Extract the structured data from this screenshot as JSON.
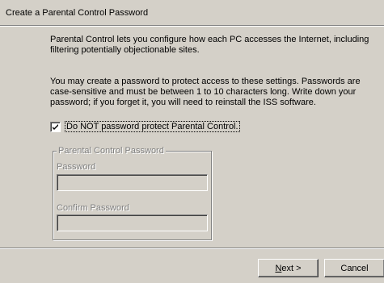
{
  "dialog": {
    "title": "Create a Parental Control Password",
    "intro": "Parental Control lets you configure how each PC accesses the Internet, including filtering potentially objectionable sites.",
    "instructions": "You may create a password to protect access to these settings. Passwords are case-sensitive and must be between 1 to 10 characters long. Write down your password; if you forget it, you will need to reinstall the ISS software."
  },
  "checkbox": {
    "label": "Do NOT password protect Parental Control.",
    "checked": true
  },
  "group": {
    "legend": "Parental Control Password",
    "password_label": "Password",
    "password_value": "",
    "confirm_label": "Confirm Password",
    "confirm_value": ""
  },
  "buttons": {
    "next_mnemonic": "N",
    "next_rest": "ext >",
    "cancel": "Cancel"
  },
  "colors": {
    "face": "#d4d0c8",
    "shadow": "#808080",
    "highlight": "#ffffff",
    "disabled_text": "#808080"
  }
}
